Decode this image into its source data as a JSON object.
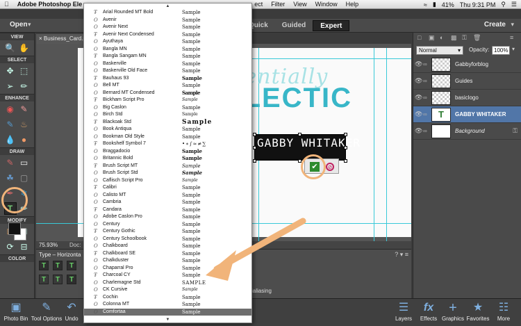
{
  "menubar": {
    "apple": "",
    "app_name": "Adobe Photoshop Ele",
    "items": [
      "ect",
      "Filter",
      "View",
      "Window",
      "Help"
    ],
    "battery": "41%",
    "clock": "Thu 9:31 PM"
  },
  "modebar": {
    "open_label": "Open",
    "tabs": [
      "Quick",
      "Guided",
      "Expert"
    ],
    "active_tab": "Expert",
    "create_label": "Create"
  },
  "toolbox": {
    "sections": [
      "VIEW",
      "SELECT",
      "ENHANCE",
      "DRAW",
      "MODIFY",
      "COLOR"
    ]
  },
  "document": {
    "tab_name": "Business_Card.p",
    "zoom": "75.93%",
    "doc_label": "Doc:",
    "logo_script": "essentially",
    "logo_main": "ECLECTIC",
    "name_text": "GABBY WHITAKER"
  },
  "tool_options": {
    "type_label": "Type – Horizonta",
    "antialias": "ialiasing"
  },
  "layers": {
    "blend_mode": "Normal",
    "opacity_label": "Opacity:",
    "opacity_value": "100%",
    "items": [
      {
        "name": "Gabbyforblog",
        "thumb": "checker",
        "selected": false
      },
      {
        "name": "Guides",
        "thumb": "checker",
        "selected": false
      },
      {
        "name": "basiclogo",
        "thumb": "checker",
        "selected": false
      },
      {
        "name": "GABBY WHITAKER",
        "thumb": "type",
        "selected": true
      },
      {
        "name": "Background",
        "thumb": "white",
        "selected": false
      }
    ]
  },
  "dock": {
    "left": [
      "Photo Bin",
      "Tool Options",
      "Undo"
    ],
    "right": [
      "Layers",
      "Effects",
      "Graphics",
      "Favorites",
      "More"
    ]
  },
  "font_dropdown": {
    "sample_label": "Sample",
    "fonts": [
      {
        "name": "Arial Rounded MT Bold",
        "sample": "Sample"
      },
      {
        "name": "Avenir",
        "sample": "Sample"
      },
      {
        "name": "Avenir Next",
        "sample": "Sample"
      },
      {
        "name": "Avenir Next Condensed",
        "sample": "Sample"
      },
      {
        "name": "Ayuthaya",
        "sample": "Sample"
      },
      {
        "name": "Bangla MN",
        "sample": "Sample"
      },
      {
        "name": "Bangla Sangam MN",
        "sample": "Sample"
      },
      {
        "name": "Baskerville",
        "sample": "Sample"
      },
      {
        "name": "Baskerville Old Face",
        "sample": "Sample"
      },
      {
        "name": "Bauhaus 93",
        "sample": "Sample"
      },
      {
        "name": "Bell MT",
        "sample": "Sample"
      },
      {
        "name": "Bernard MT Condensed",
        "sample": "Sample"
      },
      {
        "name": "Bickham Script Pro",
        "sample": "Sample"
      },
      {
        "name": "Big Caslon",
        "sample": "Sample"
      },
      {
        "name": "Birch Std",
        "sample": "Sample"
      },
      {
        "name": "Blackoak Std",
        "sample": "Sample"
      },
      {
        "name": "Book Antiqua",
        "sample": "Sample"
      },
      {
        "name": "Bookman Old Style",
        "sample": "Sample"
      },
      {
        "name": "Bookshelf Symbol 7",
        "sample": ""
      },
      {
        "name": "Braggadocio",
        "sample": "Sample"
      },
      {
        "name": "Britannic Bold",
        "sample": "Sample"
      },
      {
        "name": "Brush Script MT",
        "sample": "Sample"
      },
      {
        "name": "Brush Script Std",
        "sample": "Sample"
      },
      {
        "name": "Caflisch Script Pro",
        "sample": "Sample"
      },
      {
        "name": "Calibri",
        "sample": "Sample"
      },
      {
        "name": "Calisto MT",
        "sample": "Sample"
      },
      {
        "name": "Cambria",
        "sample": "Sample"
      },
      {
        "name": "Candara",
        "sample": "Sample"
      },
      {
        "name": "Adobe Caslon Pro",
        "sample": "Sample"
      },
      {
        "name": "Century",
        "sample": "Sample"
      },
      {
        "name": "Century Gothic",
        "sample": "Sample"
      },
      {
        "name": "Century Schoolbook",
        "sample": "Sample"
      },
      {
        "name": "Chalkboard",
        "sample": "Sample"
      },
      {
        "name": "Chalkboard SE",
        "sample": "Sample"
      },
      {
        "name": "Chalkduster",
        "sample": "Sample"
      },
      {
        "name": "Chaparral Pro",
        "sample": "Sample"
      },
      {
        "name": "Charcoal CY",
        "sample": "Sample"
      },
      {
        "name": "Charlemagne Std",
        "sample": "SAMPLE"
      },
      {
        "name": "CK Cursive",
        "sample": "Sample"
      },
      {
        "name": "Cochin",
        "sample": "Sample"
      },
      {
        "name": "Colonna MT",
        "sample": "Sample"
      },
      {
        "name": "Comfortaa",
        "sample": "Sample",
        "selected": true
      }
    ]
  },
  "colors": {
    "accent": "#5176a8",
    "highlight": "#f1b47a",
    "guide": "#38c9d8",
    "logo": "#38b6c8"
  }
}
